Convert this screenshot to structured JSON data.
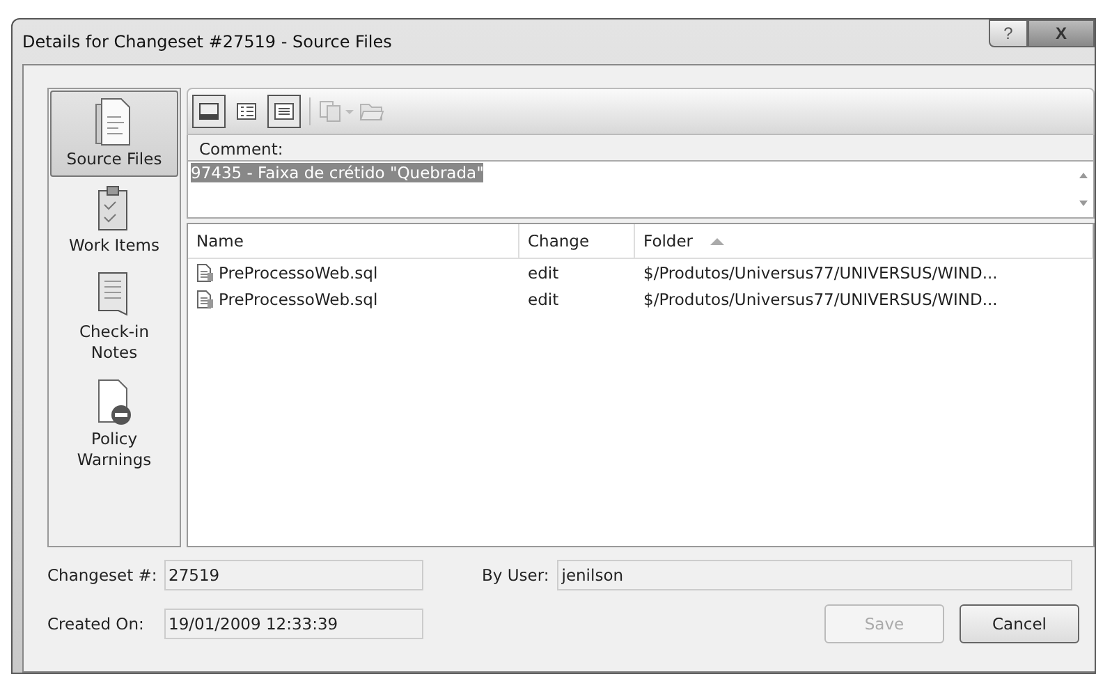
{
  "window": {
    "title": "Details for Changeset #27519 - Source Files",
    "buttons": [
      {
        "kind": "help",
        "label": "?"
      },
      {
        "kind": "close",
        "label": "X"
      }
    ]
  },
  "sidebar": {
    "items": [
      {
        "kind": "files",
        "label": "Source Files",
        "selected": true
      },
      {
        "kind": "workitems",
        "label": "Work Items",
        "selected": false
      },
      {
        "kind": "notes",
        "label": "Check-in Notes",
        "selected": false
      },
      {
        "kind": "policy",
        "label": "Policy Warnings",
        "selected": false
      }
    ]
  },
  "toolbar": {
    "view_buttons": [
      {
        "kind": "preview",
        "selected": true
      },
      {
        "kind": "details",
        "selected": false
      },
      {
        "kind": "list",
        "selected": true
      }
    ],
    "actions": [
      {
        "kind": "compare",
        "disabled": true
      },
      {
        "kind": "open",
        "disabled": true
      }
    ]
  },
  "comment": {
    "label": "Comment:",
    "value": "97435 - Faixa de crétido \"Quebrada\""
  },
  "table": {
    "columns": [
      {
        "label": "Name",
        "sorted": false
      },
      {
        "label": "Change",
        "sorted": false
      },
      {
        "label": "Folder",
        "sorted": true
      }
    ],
    "rows": [
      {
        "name": "PreProcessoWeb.sql",
        "change": "edit",
        "folder": "$/Produtos/Universus77/UNIVERSUS/WIND..."
      },
      {
        "name": "PreProcessoWeb.sql",
        "change": "edit",
        "folder": "$/Produtos/Universus77/UNIVERSUS/WIND..."
      }
    ]
  },
  "details": {
    "changeset_label": "Changeset #:",
    "changeset": "27519",
    "user_label": "By User:",
    "user": "jenilson",
    "created_label": "Created On:",
    "created": "19/01/2009 12:33:39"
  },
  "buttons": [
    {
      "label": "Save",
      "disabled": true
    },
    {
      "label": "Cancel",
      "disabled": false
    }
  ]
}
